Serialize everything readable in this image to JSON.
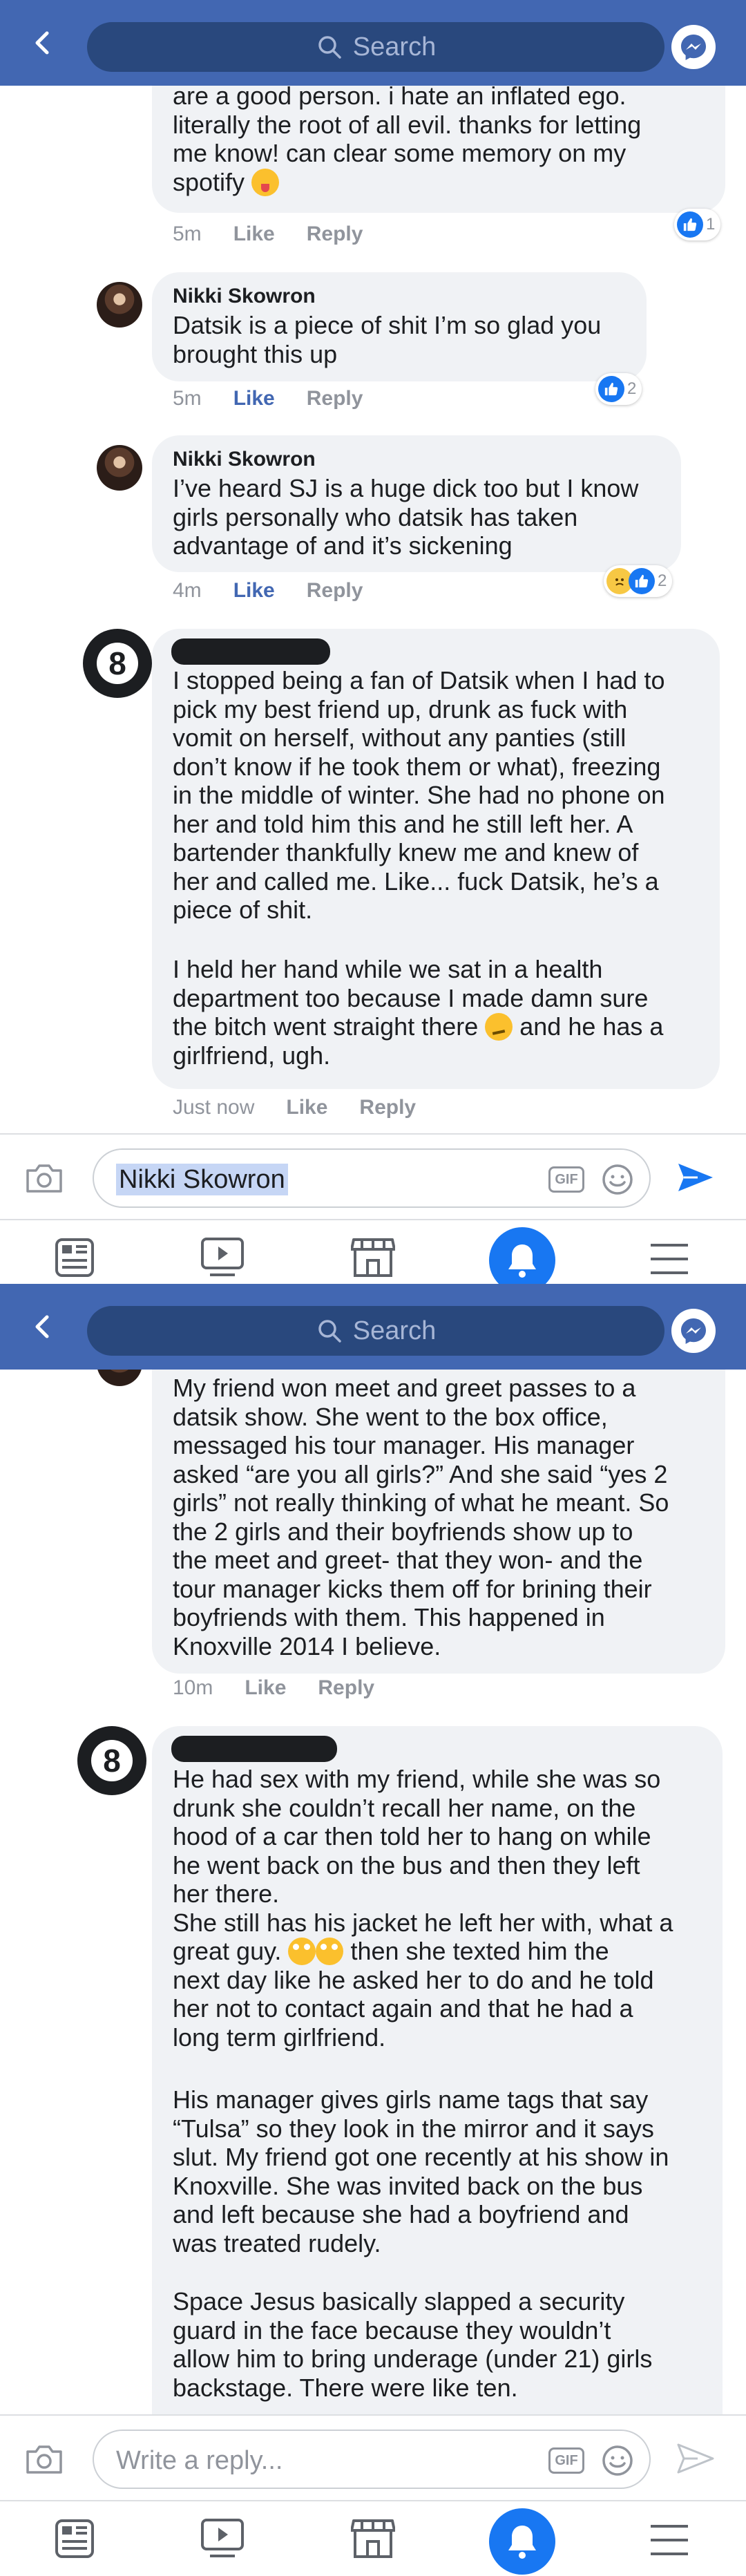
{
  "colors": {
    "brand": "#4267b2",
    "brand_dark": "#29487d",
    "like_blue": "#1877f2",
    "bubble": "#f0f2f5",
    "meta_gray": "#90949c"
  },
  "header": {
    "search_placeholder": "Search"
  },
  "screen1": {
    "comment_top": {
      "text": "are a good person. i hate an inflated ego.\nliterally the root of all evil. thanks for letting\nme know! can clear some memory on my\nspotify",
      "time": "5m",
      "like": "Like",
      "reply": "Reply",
      "reaction_count": "1"
    },
    "comment_nikki1": {
      "author": "Nikki Skowron",
      "text": "Datsik is a piece of shit I’m so glad you\nbrought this up",
      "time": "5m",
      "like": "Like",
      "reply": "Reply",
      "reaction_count": "2"
    },
    "comment_nikki2": {
      "author": "Nikki Skowron",
      "text": "I’ve heard SJ is a huge dick too but I know\ngirls personally who datsik has taken\nadvantage of and it’s sickening",
      "time": "4m",
      "like": "Like",
      "reply": "Reply",
      "reaction_count": "2"
    },
    "comment_anon": {
      "text_a": "I stopped being a fan of Datsik when I had to\npick my best friend up, drunk as fuck with\nvomit on herself, without any panties (still\ndon’t know if he took them or what), freezing\nin the middle of winter. She had no phone on\nher and told him this and he still left her. A\nbartender thankfully knew me and knew of\nher and called me. Like... fuck Datsik, he’s a\npiece of shit.",
      "text_b1": "I held her hand while we sat in a health\ndepartment too because I made damn sure\nthe bitch went straight there",
      "text_b2": " and he has a\ngirlfriend, ugh.",
      "time": "Just now",
      "like": "Like",
      "reply": "Reply"
    },
    "composer_value": "Nikki Skowron"
  },
  "screen2": {
    "comment_top": {
      "text": "My friend won meet and greet passes to a\ndatsik show. She went to the box office,\nmessaged his tour manager. His manager\nasked “are you all girls?” And she said “yes 2\ngirls” not really thinking of what he meant. So\nthe 2 girls and their boyfriends show up to\nthe meet and greet- that they won- and the\ntour manager kicks them off for brining their\nboyfriends with them. This happened in\nKnoxville 2014 I believe.",
      "time": "10m",
      "like": "Like",
      "reply": "Reply"
    },
    "comment_anon": {
      "text_a": "He had sex with my friend, while she was so\ndrunk she couldn’t recall her name, on the\nhood of a car then told her to hang on while\nhe went back on the bus and then they left\nher there.\nShe still has his jacket he left her with, what a\ngreat guy.",
      "text_a2": " then she texted him the\nnext day like he asked her to do and he told\nher not to contact again and that he had a\nlong term girlfriend.",
      "text_b": "His manager gives girls name tags that say\n“Tulsa” so they look in the mirror and it says\nslut. My friend got one recently at his show in\nKnoxville. She was invited back on the bus\nand left because she had a boyfriend and\nwas treated rudely.",
      "text_c": "Space Jesus basically slapped a security\nguard in the face because they wouldn’t\nallow him to bring underage (under 21) girls\nbackstage. There were like ten."
    },
    "composer_placeholder": "Write a reply..."
  },
  "composer": {
    "gif_label": "GIF"
  },
  "tabs": [
    "news-feed-icon",
    "video-icon",
    "marketplace-icon",
    "notifications-icon",
    "menu-icon"
  ]
}
